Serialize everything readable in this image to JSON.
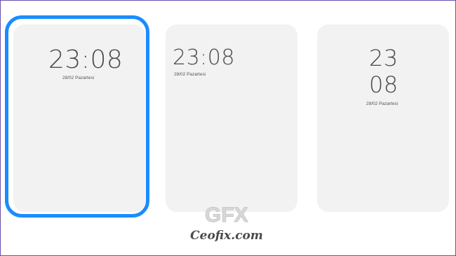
{
  "cards": [
    {
      "time": "23:08",
      "date": "28/02 Pazartesi",
      "selected": true
    },
    {
      "time": "23:08",
      "date": "28/02 Pazartesi",
      "selected": false
    },
    {
      "time_hour": "23",
      "time_minute": "08",
      "date": "28/02 Pazartesi",
      "selected": false
    }
  ],
  "watermark": {
    "text": "Ceofix.com",
    "logo_text": "GFX"
  },
  "colors": {
    "selection": "#1a8cff",
    "card_bg": "#f2f2f2",
    "frame": "#6a4fb0"
  }
}
